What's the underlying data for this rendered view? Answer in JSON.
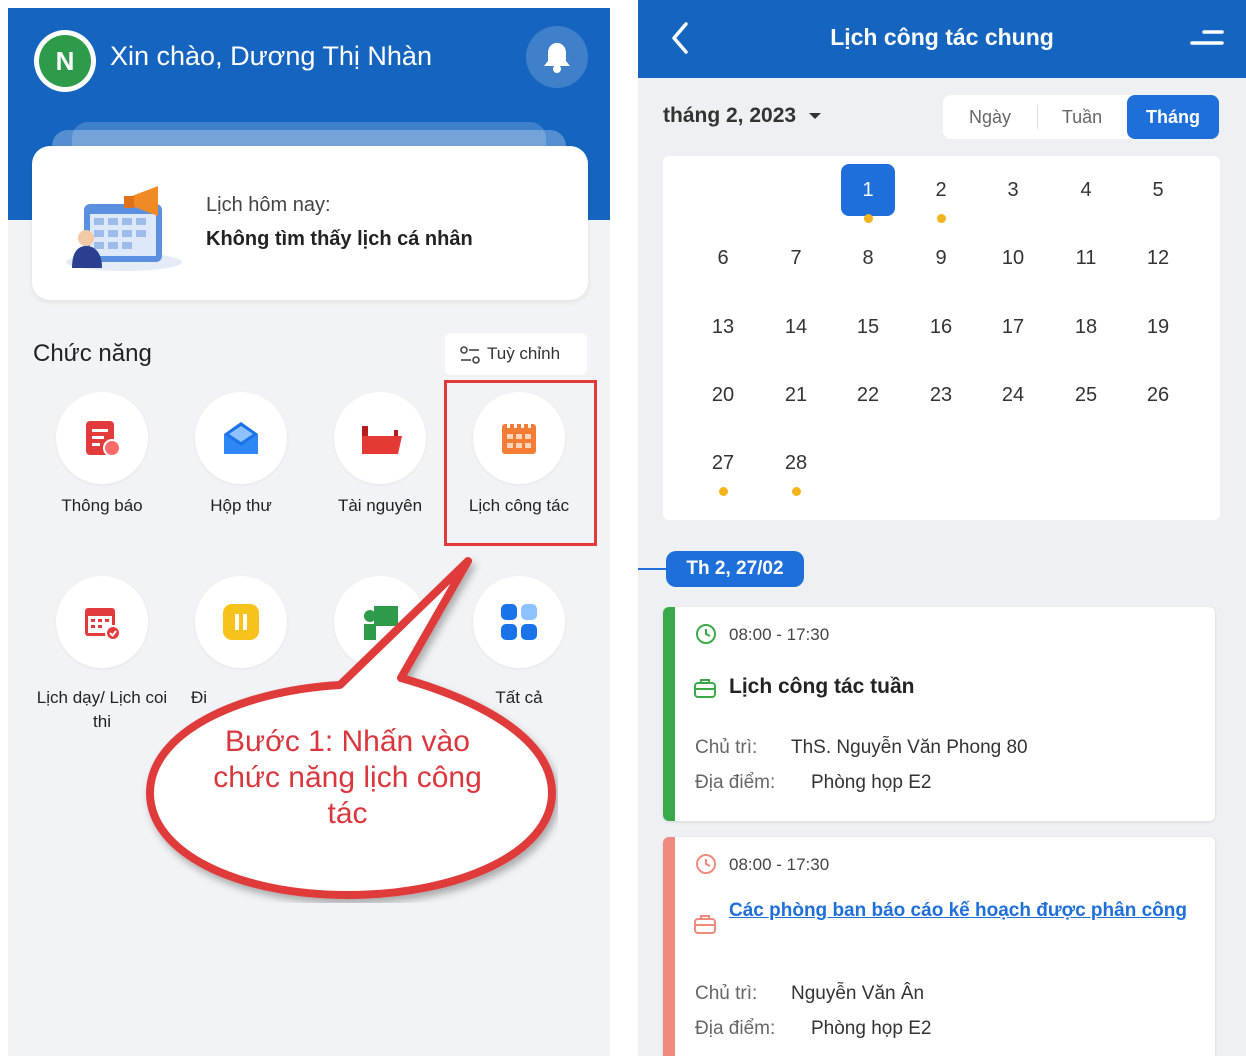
{
  "left": {
    "header": {
      "avatar_letter": "N",
      "greeting": "Xin chào, Dương Thị Nhàn"
    },
    "today_card": {
      "label": "Lịch hôm nay:",
      "value": "Không tìm thấy lịch cá nhân"
    },
    "functions": {
      "title": "Chức năng",
      "customize_label": "Tuỳ chỉnh",
      "items": [
        {
          "label": "Thông báo",
          "icon": "notification-doc-icon"
        },
        {
          "label": "Hộp thư",
          "icon": "mailbox-icon"
        },
        {
          "label": "Tài nguyên",
          "icon": "folder-icon"
        },
        {
          "label": "Lịch công tác",
          "icon": "calendar-grid-icon"
        },
        {
          "label": "Lịch dạy/ Lịch coi thi",
          "icon": "calendar-check-icon"
        },
        {
          "label": "Đi",
          "icon": "pause-badge-icon"
        },
        {
          "label": "",
          "icon": "teacher-icon"
        },
        {
          "label": "Tất cả",
          "icon": "apps-grid-icon"
        }
      ]
    },
    "callout": "Bước 1: Nhấn vào chức năng lịch công tác",
    "colors": {
      "primary": "#1565c0",
      "highlight": "#e03a3a"
    }
  },
  "right": {
    "topbar": {
      "title": "Lịch công tác chung"
    },
    "month_label": "tháng 2, 2023",
    "view_tabs": [
      {
        "label": "Ngày",
        "active": false
      },
      {
        "label": "Tuần",
        "active": false
      },
      {
        "label": "Tháng",
        "active": true
      }
    ],
    "calendar": {
      "days": [
        "1",
        "2",
        "3",
        "4",
        "5",
        "6",
        "7",
        "8",
        "9",
        "10",
        "11",
        "12",
        "13",
        "14",
        "15",
        "16",
        "17",
        "18",
        "19",
        "20",
        "21",
        "22",
        "23",
        "24",
        "25",
        "26",
        "27",
        "28"
      ],
      "selected_day": "1",
      "days_with_events": [
        "1",
        "2",
        "27",
        "28"
      ]
    },
    "date_pill": "Th 2, 27/02",
    "events": [
      {
        "time": "08:00 - 17:30",
        "title": "Lịch công tác tuần",
        "host_label": "Chủ trì:",
        "host": "ThS. Nguyễn Văn Phong 80",
        "place_label": "Địa điểm:",
        "place": "Phòng họp E2",
        "color": "#3aa94a"
      },
      {
        "time": "08:00 - 17:30",
        "title": "Các phòng ban báo cáo kế hoạch được phân công",
        "host_label": "Chủ trì:",
        "host": "Nguyễn Văn Ân",
        "place_label": "Địa điểm:",
        "place": "Phòng họp E2",
        "color": "#ee8a7e"
      }
    ]
  }
}
